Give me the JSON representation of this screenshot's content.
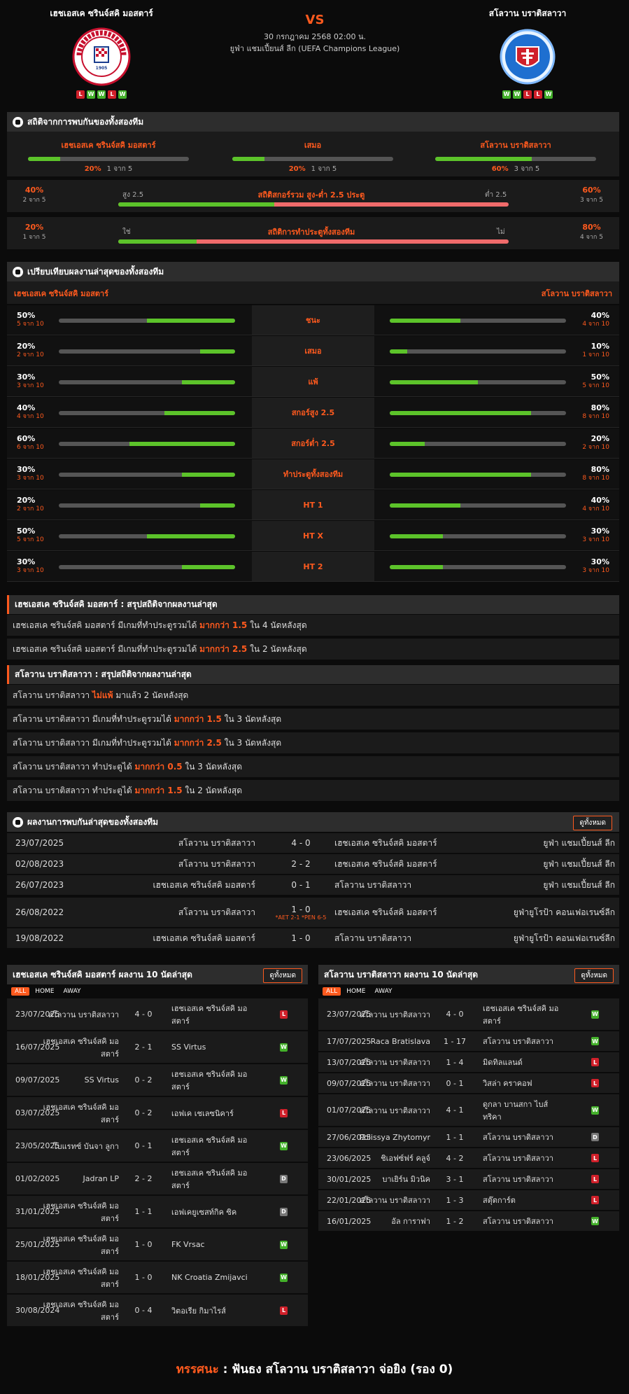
{
  "home": {
    "name": "เฮชเอสเค ซรินจ์สคิ มอสตาร์",
    "form": [
      "L",
      "W",
      "W",
      "L",
      "W"
    ],
    "logo_text": "HRVATSKI SPORTSKI KLUB · ZRINJSKI · MOSTAR",
    "logo_year": "1905"
  },
  "away": {
    "name": "สโลวาน บราติสลาวา",
    "form": [
      "W",
      "W",
      "L",
      "L",
      "W"
    ],
    "logo_text": "SLOVAN BRATISLAVA"
  },
  "match": {
    "vs": "VS",
    "datetime": "30 กรกฎาคม 2568 02:00 น.",
    "league": "ยูฟ่า แชมเปี้ยนส์ ลีก (UEFA Champions League)"
  },
  "h2h": {
    "title": "สถิติจากการพบกันของทั้งสองทีม",
    "cols": [
      {
        "label": "เฮชเอสเค ซรินจ์สคิ มอสตาร์",
        "pct": "20%",
        "of": "1 จาก 5",
        "value": 0.2
      },
      {
        "label": "เสมอ",
        "pct": "20%",
        "of": "1 จาก 5",
        "value": 0.2
      },
      {
        "label": "สโลวาน บราติสลาวา",
        "pct": "60%",
        "of": "3 จาก 5",
        "value": 0.6
      }
    ],
    "ou": {
      "title": "สถิติสกอร์รวม สูง-ต่ำ 2.5 ประตู",
      "left_pct": "40%",
      "left_of": "2 จาก 5",
      "left_lbl": "สูง 2.5",
      "right_lbl": "ต่ำ 2.5",
      "right_pct": "60%",
      "right_of": "3 จาก 5",
      "value": 0.4
    },
    "btts": {
      "title": "สถิติการทำประตูทั้งสองทีม",
      "left_pct": "20%",
      "left_of": "1 จาก 5",
      "left_lbl": "ใช่",
      "right_lbl": "ไม่",
      "right_pct": "80%",
      "right_of": "4 จาก 5",
      "value": 0.2
    }
  },
  "compare": {
    "title": "เปรียบเทียบผลงานล่าสุดของทั้งสองทีม",
    "home": "เฮชเอสเค ซรินจ์สคิ มอสตาร์",
    "away": "สโลวาน บราติสลาวา",
    "rows": [
      {
        "label": "ชนะ",
        "hp": "50%",
        "hof": "5 จาก 10",
        "hv": 0.5,
        "ap": "40%",
        "aof": "4 จาก 10",
        "av": 0.4
      },
      {
        "label": "เสมอ",
        "hp": "20%",
        "hof": "2 จาก 10",
        "hv": 0.2,
        "ap": "10%",
        "aof": "1 จาก 10",
        "av": 0.1
      },
      {
        "label": "แพ้",
        "hp": "30%",
        "hof": "3 จาก 10",
        "hv": 0.3,
        "ap": "50%",
        "aof": "5 จาก 10",
        "av": 0.5
      },
      {
        "label": "สกอร์สูง 2.5",
        "hp": "40%",
        "hof": "4 จาก 10",
        "hv": 0.4,
        "ap": "80%",
        "aof": "8 จาก 10",
        "av": 0.8
      },
      {
        "label": "สกอร์ต่ำ 2.5",
        "hp": "60%",
        "hof": "6 จาก 10",
        "hv": 0.6,
        "ap": "20%",
        "aof": "2 จาก 10",
        "av": 0.2
      },
      {
        "label": "ทำประตูทั้งสองทีม",
        "hp": "30%",
        "hof": "3 จาก 10",
        "hv": 0.3,
        "ap": "80%",
        "aof": "8 จาก 10",
        "av": 0.8
      },
      {
        "label": "HT 1",
        "hp": "20%",
        "hof": "2 จาก 10",
        "hv": 0.2,
        "ap": "40%",
        "aof": "4 จาก 10",
        "av": 0.4
      },
      {
        "label": "HT X",
        "hp": "50%",
        "hof": "5 จาก 10",
        "hv": 0.5,
        "ap": "30%",
        "aof": "3 จาก 10",
        "av": 0.3
      },
      {
        "label": "HT 2",
        "hp": "30%",
        "hof": "3 จาก 10",
        "hv": 0.3,
        "ap": "30%",
        "aof": "3 จาก 10",
        "av": 0.3
      }
    ]
  },
  "summary_home": {
    "title": "เฮชเอสเค ซรินจ์สคิ มอสตาร์ : สรุปสถิติจากผลงานล่าสุด",
    "rows": [
      {
        "pre": "เฮชเอสเค ซรินจ์สคิ มอสตาร์  มีเกมที่ทำประตูรวมได้ ",
        "hl": "มากกว่า 1.5",
        "post": " ใน 4 นัดหลังสุด"
      },
      {
        "pre": "เฮชเอสเค ซรินจ์สคิ มอสตาร์  มีเกมที่ทำประตูรวมได้ ",
        "hl": "มากกว่า 2.5",
        "post": " ใน 2 นัดหลังสุด"
      }
    ]
  },
  "summary_away": {
    "title": "สโลวาน บราติสลาวา : สรุปสถิติจากผลงานล่าสุด",
    "rows": [
      {
        "pre": "สโลวาน บราติสลาวา ",
        "hl": "ไม่แพ้",
        "post": " มาแล้ว 2 นัดหลังสุด"
      },
      {
        "pre": "สโลวาน บราติสลาวา  มีเกมที่ทำประตูรวมได้ ",
        "hl": "มากกว่า 1.5",
        "post": " ใน 3 นัดหลังสุด"
      },
      {
        "pre": "สโลวาน บราติสลาวา  มีเกมที่ทำประตูรวมได้ ",
        "hl": "มากกว่า 2.5",
        "post": " ใน 3 นัดหลังสุด"
      },
      {
        "pre": "สโลวาน บราติสลาวา  ทำประตูได้ ",
        "hl": "มากกว่า 0.5",
        "post": " ใน 3 นัดหลังสุด"
      },
      {
        "pre": "สโลวาน บราติสลาวา  ทำประตูได้ ",
        "hl": "มากกว่า 1.5",
        "post": " ใน 2 นัดหลังสุด"
      }
    ]
  },
  "meetings": {
    "title": "ผลงานการพบกันล่าสุดของทั้งสองทีม",
    "all": "ดูทั้งหมด",
    "rows": [
      {
        "date": "23/07/2025",
        "home": "สโลวาน บราติสลาวา",
        "score": "4 - 0",
        "note": "",
        "away": "เฮชเอสเค ซรินจ์สคิ มอสตาร์",
        "league": "ยูฟ่า แชมเปี้ยนส์ ลีก"
      },
      {
        "date": "02/08/2023",
        "home": "สโลวาน บราติสลาวา",
        "score": "2 - 2",
        "note": "",
        "away": "เฮชเอสเค ซรินจ์สคิ มอสตาร์",
        "league": "ยูฟ่า แชมเปี้ยนส์ ลีก"
      },
      {
        "date": "26/07/2023",
        "home": "เฮชเอสเค ซรินจ์สคิ มอสตาร์",
        "score": "0 - 1",
        "note": "",
        "away": "สโลวาน บราติสลาวา",
        "league": "ยูฟ่า แชมเปี้ยนส์ ลีก"
      },
      {
        "date": "26/08/2022",
        "home": "สโลวาน บราติสลาวา",
        "score": "1 - 0",
        "note": "*AET 2-1 *PEN 6-5",
        "away": "เฮชเอสเค ซรินจ์สคิ มอสตาร์",
        "league": "ยูฟ่ายูโรป้า คอนเฟอเรนซ์ลีก"
      },
      {
        "date": "19/08/2022",
        "home": "เฮชเอสเค ซรินจ์สคิ มอสตาร์",
        "score": "1 - 0",
        "note": "",
        "away": "สโลวาน บราติสลาวา",
        "league": "ยูฟ่ายูโรป้า คอนเฟอเรนซ์ลีก"
      }
    ]
  },
  "last_home": {
    "title": "เฮชเอสเค ซรินจ์สคิ มอสตาร์ ผลงาน 10 นัดล่าสุด",
    "all": "ดูทั้งหมด",
    "tabs": [
      "ALL",
      "HOME",
      "AWAY"
    ],
    "rows": [
      {
        "date": "23/07/2025",
        "home": "สโลวาน บราติสลาวา",
        "score": "4 - 0",
        "away": "เฮชเอสเค ซรินจ์สคิ มอสตาร์",
        "r": "L"
      },
      {
        "date": "16/07/2025",
        "home": "เฮชเอสเค ซรินจ์สคิ มอสตาร์",
        "score": "2 - 1",
        "away": "SS Virtus",
        "r": "W"
      },
      {
        "date": "09/07/2025",
        "home": "SS Virtus",
        "score": "0 - 2",
        "away": "เฮชเอสเค ซรินจ์สคิ มอสตาร์",
        "r": "W"
      },
      {
        "date": "03/07/2025",
        "home": "เฮชเอสเค ซรินจ์สคิ มอสตาร์",
        "score": "0 - 2",
        "away": "เอฟเค เชเลซนิคาร์",
        "r": "L"
      },
      {
        "date": "23/05/2025",
        "home": "โบแรทซ์ บันจา ลูกา",
        "score": "0 - 1",
        "away": "เฮชเอสเค ซรินจ์สคิ มอสตาร์",
        "r": "W"
      },
      {
        "date": "01/02/2025",
        "home": "Jadran LP",
        "score": "2 - 2",
        "away": "เฮชเอสเค ซรินจ์สคิ มอสตาร์",
        "r": "D"
      },
      {
        "date": "31/01/2025",
        "home": "เฮชเอสเค ซรินจ์สคิ มอสตาร์",
        "score": "1 - 1",
        "away": "เอฟเคยูเซสท์กิค ซิค",
        "r": "D"
      },
      {
        "date": "25/01/2025",
        "home": "เฮชเอสเค ซรินจ์สคิ มอสตาร์",
        "score": "1 - 0",
        "away": "FK Vrsac",
        "r": "W"
      },
      {
        "date": "18/01/2025",
        "home": "เฮชเอสเค ซรินจ์สคิ มอสตาร์",
        "score": "1 - 0",
        "away": "NK Croatia Zmijavci",
        "r": "W"
      },
      {
        "date": "30/08/2024",
        "home": "เฮชเอสเค ซรินจ์สคิ มอสตาร์",
        "score": "0 - 4",
        "away": "วิตอเรีย กิมาไรส์",
        "r": "L"
      }
    ]
  },
  "last_away": {
    "title": "สโลวาน บราติสลาวา ผลงาน 10 นัดล่าสุด",
    "all": "ดูทั้งหมด",
    "tabs": [
      "ALL",
      "HOME",
      "AWAY"
    ],
    "rows": [
      {
        "date": "23/07/2025",
        "home": "สโลวาน บราติสลาวา",
        "score": "4 - 0",
        "away": "เฮชเอสเค ซรินจ์สคิ มอสตาร์",
        "r": "W"
      },
      {
        "date": "17/07/2025",
        "home": "Raca Bratislava",
        "score": "1 - 17",
        "away": "สโลวาน บราติสลาวา",
        "r": "W"
      },
      {
        "date": "13/07/2025",
        "home": "สโลวาน บราติสลาวา",
        "score": "1 - 4",
        "away": "มิดทิลแลนด์",
        "r": "L"
      },
      {
        "date": "09/07/2025",
        "home": "สโลวาน บราติสลาวา",
        "score": "0 - 1",
        "away": "วิสล่า คราคอฟ",
        "r": "L"
      },
      {
        "date": "01/07/2025",
        "home": "สโลวาน บราติสลาวา",
        "score": "4 - 1",
        "away": "ดูกลา บานสกา ไบส์ทริคา",
        "r": "W"
      },
      {
        "date": "27/06/2025",
        "home": "Polissya Zhytomyr",
        "score": "1 - 1",
        "away": "สโลวาน บราติสลาวา",
        "r": "D"
      },
      {
        "date": "23/06/2025",
        "home": "ชิเอฟซ์ฟร์ คลูจ์",
        "score": "4 - 2",
        "away": "สโลวาน บราติสลาวา",
        "r": "L"
      },
      {
        "date": "30/01/2025",
        "home": "บาเยิร์น มิวนิค",
        "score": "3 - 1",
        "away": "สโลวาน บราติสลาวา",
        "r": "L"
      },
      {
        "date": "22/01/2025",
        "home": "สโลวาน บราติสลาวา",
        "score": "1 - 3",
        "away": "สตุ๊ตการ์ต",
        "r": "L"
      },
      {
        "date": "16/01/2025",
        "home": "อัล การาฟา",
        "score": "1 - 2",
        "away": "สโลวาน บราติสลาวา",
        "r": "W"
      }
    ]
  },
  "verdict": {
    "label": "ทรรศนะ",
    "sep": " :  ",
    "text": "ฟันธง สโลวาน บราติสลาวา จ่อยิง (รอง 0)"
  },
  "colors": {
    "accent": "#ff5a1e",
    "win": "#43b02a",
    "loss": "#d0202a",
    "draw": "#777777",
    "bar_green": "#5cc32a",
    "bar_red": "#f06b6b"
  }
}
